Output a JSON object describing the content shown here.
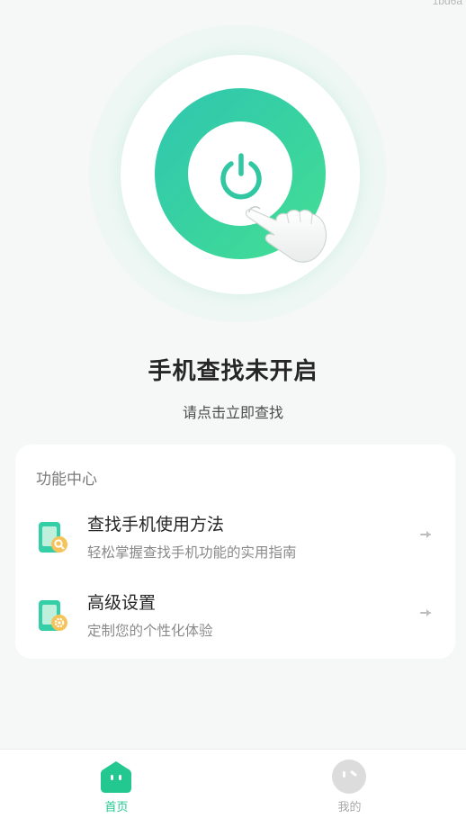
{
  "corner_text": "1bd6a",
  "hero": {
    "power_icon": "power-icon",
    "hand_icon": "pointing-hand-icon",
    "accent_color": "#36d0a4"
  },
  "status": {
    "title": "手机查找未开启",
    "subtitle": "请点击立即查找"
  },
  "features": {
    "title": "功能中心",
    "items": [
      {
        "label": "查找手机使用方法",
        "desc": "轻松掌握查找手机功能的实用指南",
        "icon": "phone-search-icon"
      },
      {
        "label": "高级设置",
        "desc": "定制您的个性化体验",
        "icon": "phone-settings-icon"
      }
    ]
  },
  "tabbar": {
    "tabs": [
      {
        "label": "首页",
        "icon": "home-icon",
        "active": true,
        "color": "#22c88f"
      },
      {
        "label": "我的",
        "icon": "profile-icon",
        "active": false,
        "color": "#a8a8a8"
      }
    ]
  }
}
